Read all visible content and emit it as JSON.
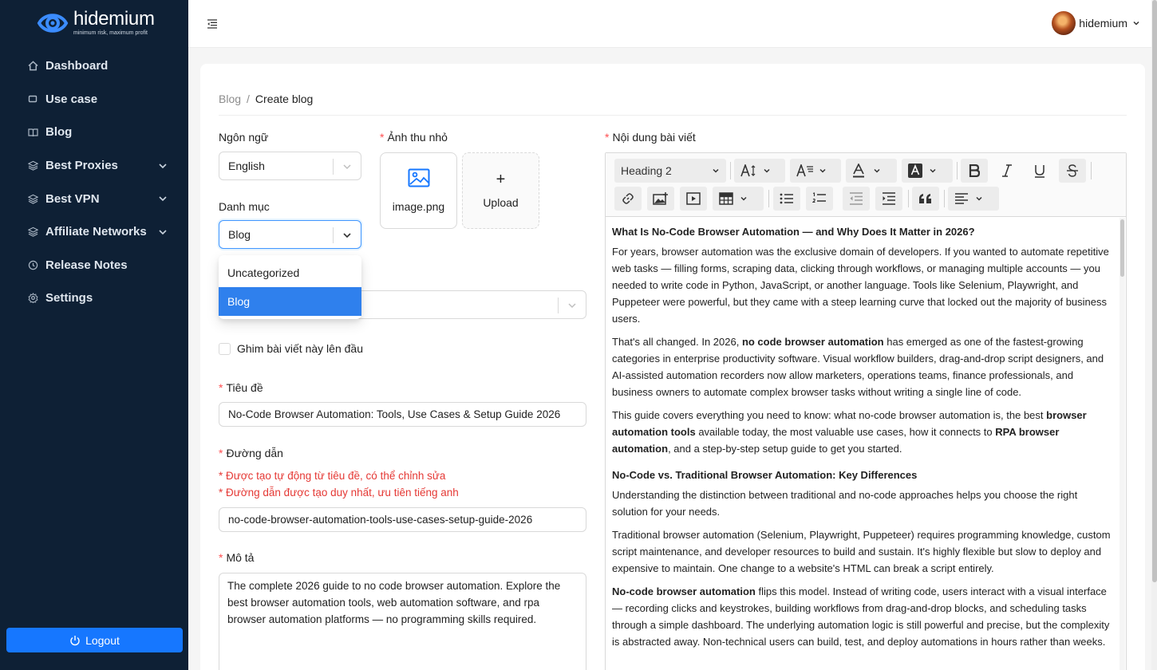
{
  "brand": {
    "name": "hidemium",
    "tagline": "minimum risk, maximum profit"
  },
  "sidebar": {
    "items": [
      {
        "label": "Dashboard",
        "icon": "home-icon",
        "has_children": false
      },
      {
        "label": "Use case",
        "icon": "square-icon",
        "has_children": false
      },
      {
        "label": "Blog",
        "icon": "book-icon",
        "has_children": false
      },
      {
        "label": "Best Proxies",
        "icon": "layers-icon",
        "has_children": true
      },
      {
        "label": "Best VPN",
        "icon": "layers-icon",
        "has_children": true
      },
      {
        "label": "Affiliate Networks",
        "icon": "layers-icon",
        "has_children": true
      },
      {
        "label": "Release Notes",
        "icon": "clock-icon",
        "has_children": false
      },
      {
        "label": "Settings",
        "icon": "gear-icon",
        "has_children": false
      }
    ],
    "logout_label": "Logout"
  },
  "header": {
    "user_name": "hidemium"
  },
  "breadcrumb": {
    "parent": "Blog",
    "separator": "/",
    "current": "Create blog"
  },
  "form": {
    "language": {
      "label": "Ngôn ngữ",
      "value": "English"
    },
    "category": {
      "label": "Danh mục",
      "value": "Blog",
      "options": [
        "Uncategorized",
        "Blog"
      ],
      "selected": "Blog"
    },
    "thumbnail": {
      "label": "Ảnh thu nhỏ",
      "file_name": "image.png",
      "upload_label": "Upload",
      "upload_plus": "+"
    },
    "pin": {
      "label": "Ghim bài viết này lên đầu",
      "checked": false
    },
    "title": {
      "label": "Tiêu đề",
      "value": "No-Code Browser Automation: Tools, Use Cases & Setup Guide 2026"
    },
    "slug": {
      "label": "Đường dẫn",
      "hint1": "* Được tạo tự động từ tiêu đề, có thể chỉnh sửa",
      "hint2": "* Đường dẫn được tạo duy nhất, ưu tiên tiếng anh",
      "value": "no-code-browser-automation-tools-use-cases-setup-guide-2026"
    },
    "description": {
      "label": "Mô tả",
      "value": "The complete 2026 guide to no code browser automation. Explore the best browser automation tools, web automation software, and rpa browser automation platforms — no programming skills required."
    },
    "required_mark": "*"
  },
  "editor": {
    "label": "Nội dung bài viết",
    "block_format": "Heading 2",
    "content": {
      "h1": "What Is No-Code Browser Automation — and Why Does It Matter in 2026?",
      "p1": "For years, browser automation was the exclusive domain of developers. If you wanted to automate repetitive web tasks — filling forms, scraping data, clicking through workflows, or managing multiple accounts — you needed to write code in Python, JavaScript, or another language. Tools like Selenium, Playwright, and Puppeteer were powerful, but they came with a steep learning curve that locked out the majority of business users.",
      "p2a": "That's all changed. In 2026, ",
      "p2b": "no code browser automation",
      "p2c": " has emerged as one of the fastest-growing categories in enterprise productivity software. Visual workflow builders, drag-and-drop script designers, and AI-assisted automation recorders now allow marketers, operations teams, finance professionals, and business owners to automate complex browser tasks without writing a single line of code.",
      "p3a": "This guide covers everything you need to know: what no-code browser automation is, the best ",
      "p3b": "browser automation tools",
      "p3c": " available today, the most valuable use cases, how it connects to ",
      "p3d": "RPA browser automation",
      "p3e": ", and a step-by-step setup guide to get you started.",
      "h2": "No-Code vs. Traditional Browser Automation: Key Differences",
      "p4": "Understanding the distinction between traditional and no-code approaches helps you choose the right solution for your needs.",
      "p5": "Traditional browser automation (Selenium, Playwright, Puppeteer) requires programming knowledge, custom script maintenance, and developer resources to build and sustain. It's highly flexible but slow to deploy and expensive to maintain. One change to a website's HTML can break a script entirely.",
      "p6a": "No-code browser automation",
      "p6b": " flips this model. Instead of writing code, users interact with a visual interface — recording clicks and keystrokes, building workflows from drag-and-drop blocks, and scheduling tasks through a simple dashboard. The underlying automation logic is still powerful and precise, but the complexity is abstracted away. Non-technical users can build, test, and deploy automations in hours rather than weeks."
    }
  },
  "colors": {
    "sidebar_bg": "#0e2035",
    "primary": "#1677ff",
    "selected_option": "#2f80ed",
    "required": "#ff4d4f",
    "hint": "#e53935"
  }
}
